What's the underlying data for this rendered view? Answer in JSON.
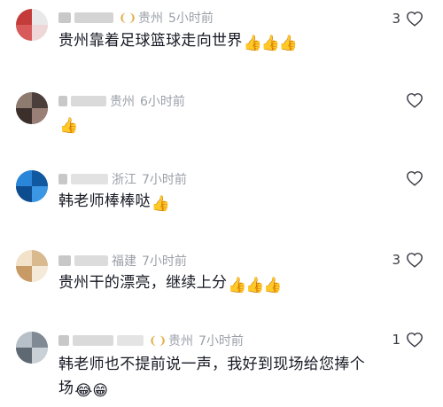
{
  "comments": [
    {
      "id": "c1",
      "location": "贵州",
      "time": "5小时前",
      "text": "贵州靠着足球篮球走向世界",
      "likes": "3",
      "emojis": [
        "thumbs-up",
        "thumbs-up",
        "thumbs-up"
      ]
    },
    {
      "id": "c2",
      "location": "贵州",
      "time": "6小时前",
      "text": "",
      "likes": "",
      "emojis": [
        "thumbs-up"
      ]
    },
    {
      "id": "c3",
      "location": "浙江",
      "time": "7小时前",
      "text": "韩老师棒棒哒",
      "likes": "",
      "emojis": [
        "thumbs-up"
      ]
    },
    {
      "id": "c4",
      "location": "福建",
      "time": "7小时前",
      "text": "贵州干的漂亮，继续上分",
      "likes": "3",
      "emojis": [
        "thumbs-up",
        "thumbs-up",
        "thumbs-up"
      ]
    },
    {
      "id": "c5",
      "location": "贵州",
      "time": "7小时前",
      "text_line1": "韩老师也不提前说一声，我好到现场给您捧个",
      "text_line2": "场",
      "likes": "1",
      "emojis": [
        "tears-of-joy",
        "grinning"
      ]
    }
  ],
  "colors": {
    "meta": "#9aa0a8",
    "text": "#161823",
    "like_icon": "#3a3d45",
    "badge": "#e0b04a"
  },
  "icons": {
    "like": "heart-outline-icon",
    "badge": "fan-badge-icon",
    "emoji": "thumbs-up-emoji"
  }
}
